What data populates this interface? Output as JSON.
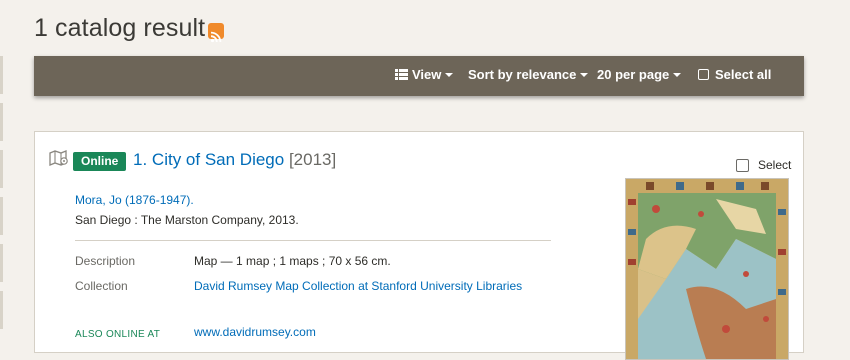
{
  "results": {
    "heading": "1 catalog result"
  },
  "toolbar": {
    "view_label": "View",
    "sort_label": "Sort by relevance",
    "per_page_label": "20 per page",
    "select_all_label": "Select all"
  },
  "document": {
    "badge": "Online",
    "number": "1.",
    "title": "City of San Diego",
    "year": "[2013]",
    "select_label": "Select",
    "author": "Mora, Jo (1876-1947).",
    "imprint": "San Diego : The Marston Company, 2013.",
    "fields": [
      {
        "label": "Description",
        "value": "Map — 1 map ; 1 maps ; 70 x 56 cm."
      },
      {
        "label": "Collection",
        "value": "David Rumsey Map Collection at Stanford University Libraries"
      }
    ],
    "also_online_label": "ALSO ONLINE AT",
    "also_online_link": "www.davidrumsey.com"
  },
  "colors": {
    "toolbar_bg": "#6d6558",
    "link": "#006cb8",
    "online_badge": "#1a8758",
    "rss": "#f08a2b"
  },
  "icons": [
    "rss-icon",
    "list-view-icon",
    "map-icon",
    "checkbox-icon"
  ]
}
